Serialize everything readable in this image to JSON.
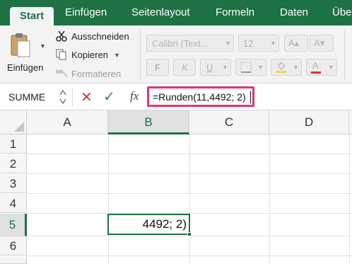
{
  "tabs": [
    {
      "label": "Start",
      "active": true
    },
    {
      "label": "Einfügen"
    },
    {
      "label": "Seitenlayout"
    },
    {
      "label": "Formeln"
    },
    {
      "label": "Daten"
    },
    {
      "label": "Übe"
    }
  ],
  "ribbon": {
    "paste_label": "Einfügen",
    "cut_label": "Ausschneiden",
    "copy_label": "Kopieren",
    "format_painter_label": "Formatieren",
    "font_name": "Calibri (Text...",
    "font_size": "12",
    "bold_label": "F",
    "italic_label": "K",
    "underline_label": "U",
    "font_color_letter": "A",
    "grow_font_label": "A▴",
    "shrink_font_label": "A▾",
    "accent_color": "#1e7145",
    "fill_color": "#f5d43c",
    "font_color": "#d9342b"
  },
  "formula_bar": {
    "name_box": "SUMME",
    "cancel_symbol": "✕",
    "enter_symbol": "✓",
    "fx_label": "fx",
    "formula": "=Runden(11,4492; 2)",
    "highlight_color": "#e8317b"
  },
  "grid": {
    "columns": [
      "A",
      "B",
      "C",
      "D"
    ],
    "rows": [
      "1",
      "2",
      "3",
      "4",
      "5",
      "6"
    ],
    "selected_column": "B",
    "selected_row": "5",
    "active_cell_text": "4492; 2)"
  }
}
